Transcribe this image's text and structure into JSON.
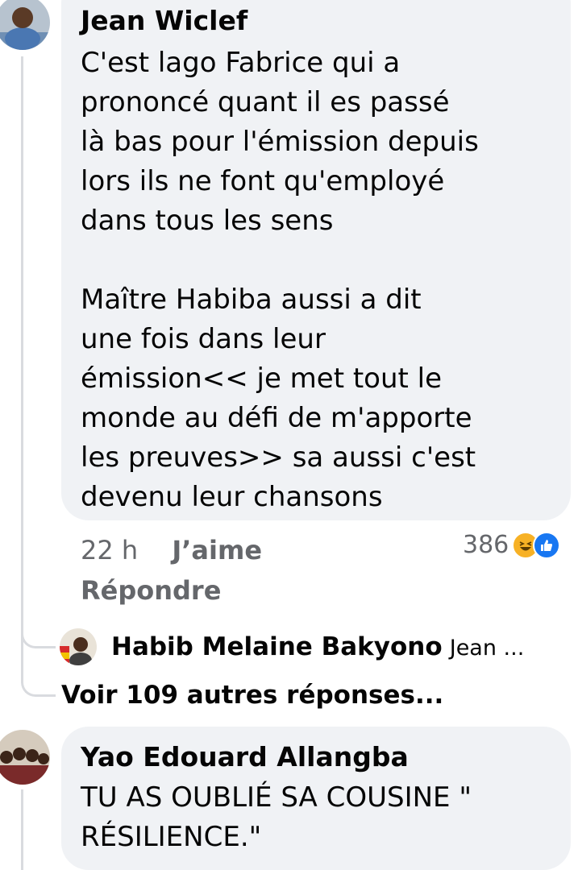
{
  "comment1": {
    "author": "Jean Wiclef",
    "paragraph1": [
      "C'est lago Fabrice qui a",
      "prononcé quant il es passé",
      "là bas pour l'émission depuis",
      "lors ils ne font qu'employé",
      "dans tous les sens"
    ],
    "paragraph2": [
      "Maître Habiba aussi a dit",
      "une fois dans leur",
      "émission<< je met tout le",
      "monde au défi de m'apporte",
      "les preuves>> sa aussi c'est",
      "devenu leur chansons"
    ],
    "time": "22 h",
    "like_label": "J’aime",
    "reply_label": "Répondre",
    "reaction_count": "386",
    "reaction_icons": [
      "haha-icon",
      "like-icon"
    ],
    "reaction_colors": {
      "haha": "#f7b125",
      "like": "#1877f2"
    }
  },
  "reply_preview": {
    "author": "Habib Melaine Bakyono",
    "snippet": "Jean ..."
  },
  "more_replies": "Voir 109 autres réponses...",
  "comment2": {
    "author": "Yao Edouard Allangba",
    "lines": [
      "TU AS OUBLIÉ SA COUSINE \"",
      "RÉSILIENCE.\""
    ]
  }
}
